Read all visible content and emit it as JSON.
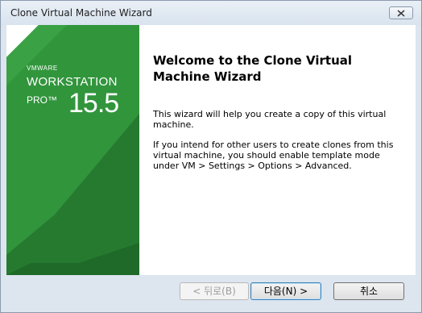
{
  "window": {
    "title": "Clone Virtual Machine Wizard"
  },
  "banner": {
    "vendor": "VMWARE",
    "product": "WORKSTATION",
    "edition": "PRO™",
    "version": "15.5"
  },
  "page": {
    "heading": "Welcome to the Clone Virtual Machine Wizard",
    "paragraph1": "This wizard will help you create a copy of this virtual machine.",
    "paragraph2": "If you intend for other users to create clones from this virtual machine, you should enable template mode under VM > Settings > Options > Advanced."
  },
  "buttons": {
    "back": "< 뒤로(B)",
    "next": "다음(N) >",
    "cancel": "취소"
  },
  "colors": {
    "banner_green": "#2d8a37",
    "banner_dark_green": "#236b2c"
  },
  "icons": {
    "close": "close-icon"
  }
}
